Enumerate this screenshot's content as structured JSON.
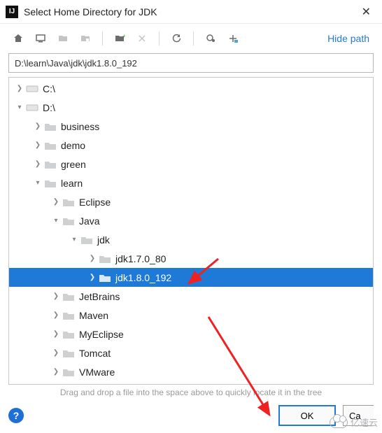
{
  "window": {
    "title": "Select Home Directory for JDK"
  },
  "toolbar": {
    "hide_path": "Hide path"
  },
  "path": {
    "value": "D:\\learn\\Java\\jdk\\jdk1.8.0_192"
  },
  "tree": {
    "nodes": [
      {
        "depth": 0,
        "expand": "collapsed",
        "icon": "drive",
        "label": "C:\\"
      },
      {
        "depth": 0,
        "expand": "expanded",
        "icon": "drive",
        "label": "D:\\"
      },
      {
        "depth": 1,
        "expand": "collapsed",
        "icon": "folder",
        "label": "business"
      },
      {
        "depth": 1,
        "expand": "collapsed",
        "icon": "folder",
        "label": "demo"
      },
      {
        "depth": 1,
        "expand": "collapsed",
        "icon": "folder",
        "label": "green"
      },
      {
        "depth": 1,
        "expand": "expanded",
        "icon": "folder",
        "label": "learn"
      },
      {
        "depth": 2,
        "expand": "collapsed",
        "icon": "folder",
        "label": "Eclipse"
      },
      {
        "depth": 2,
        "expand": "expanded",
        "icon": "folder",
        "label": "Java"
      },
      {
        "depth": 3,
        "expand": "expanded",
        "icon": "folder",
        "label": "jdk"
      },
      {
        "depth": 4,
        "expand": "collapsed",
        "icon": "folder",
        "label": "jdk1.7.0_80"
      },
      {
        "depth": 4,
        "expand": "collapsed",
        "icon": "folder",
        "label": "jdk1.8.0_192",
        "selected": true
      },
      {
        "depth": 2,
        "expand": "collapsed",
        "icon": "folder",
        "label": "JetBrains"
      },
      {
        "depth": 2,
        "expand": "collapsed",
        "icon": "folder",
        "label": "Maven"
      },
      {
        "depth": 2,
        "expand": "collapsed",
        "icon": "folder",
        "label": "MyEclipse"
      },
      {
        "depth": 2,
        "expand": "collapsed",
        "icon": "folder",
        "label": "Tomcat"
      },
      {
        "depth": 2,
        "expand": "collapsed",
        "icon": "folder",
        "label": "VMware"
      }
    ]
  },
  "hint": {
    "text": "Drag and drop a file into the space above to quickly locate it in the tree"
  },
  "buttons": {
    "ok": "OK",
    "cancel_partial": "Ca"
  },
  "watermark": {
    "text": "亿速云"
  }
}
